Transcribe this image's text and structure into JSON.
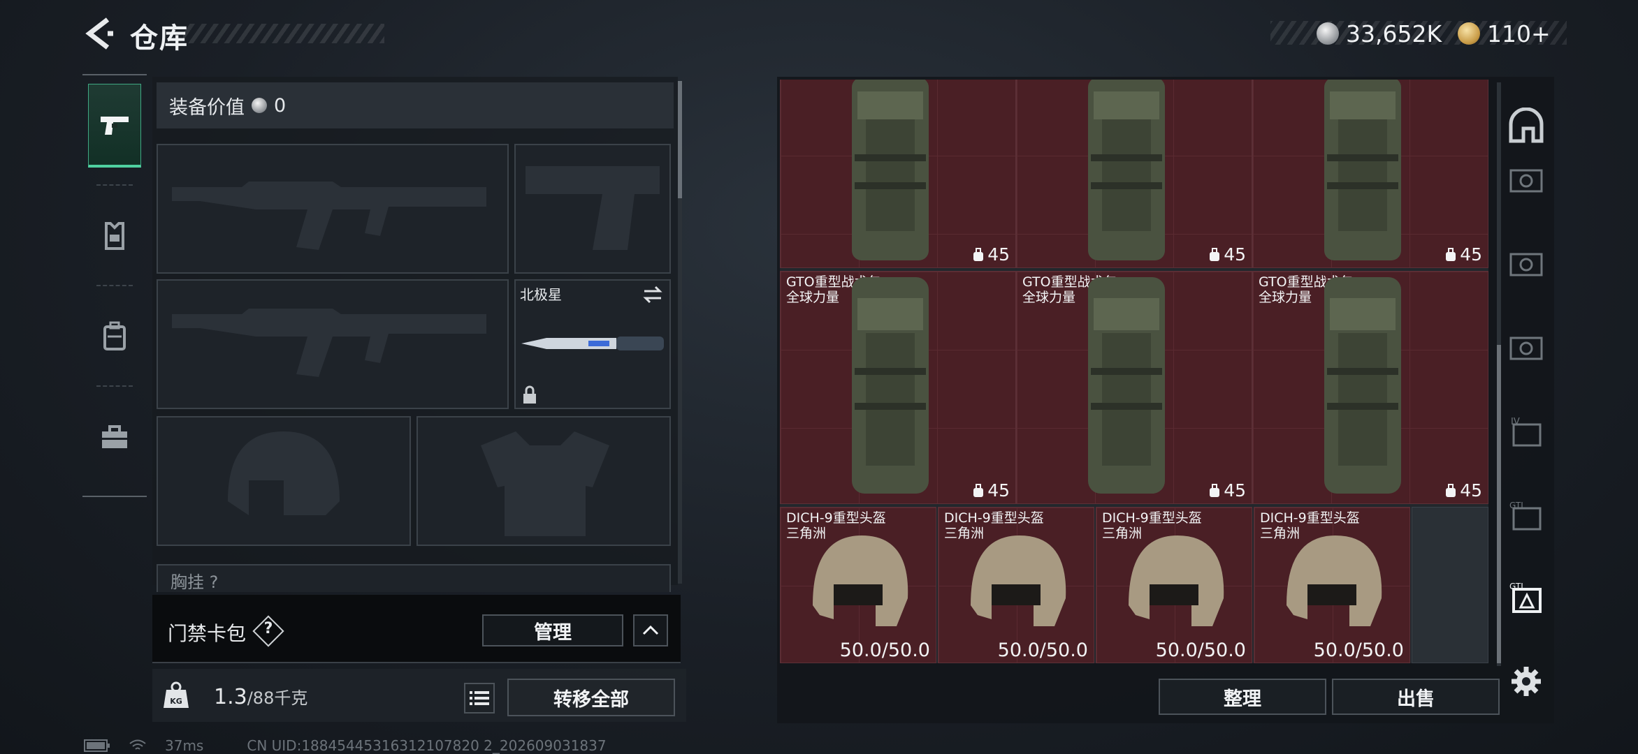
{
  "header": {
    "title": "仓库",
    "currencies": [
      {
        "icon": "silver-coin-icon",
        "value": "33,652K"
      },
      {
        "icon": "gold-coin-icon",
        "value": "110+"
      }
    ]
  },
  "tabs": [
    {
      "name": "pistol-icon",
      "active": true
    },
    {
      "name": "armor-rig-icon",
      "active": false
    },
    {
      "name": "backpack-icon",
      "active": false
    },
    {
      "name": "toolbox-icon",
      "active": false
    }
  ],
  "equipment": {
    "value_label": "装备价值",
    "value": "0",
    "melee_name": "北极星",
    "next_section": "胸挂 ?"
  },
  "keycard": {
    "label": "门禁卡包",
    "help": "?",
    "manage_label": "管理"
  },
  "weight": {
    "current": "1.3",
    "capacity": "/88千克"
  },
  "transfer_all_label": "转移全部",
  "storage": {
    "backpacks": [
      {
        "name": "",
        "count": "45"
      },
      {
        "name": "",
        "count": "45"
      },
      {
        "name": "",
        "count": "45"
      },
      {
        "name": "GTO重型战术包\n全球力量",
        "count": "45"
      },
      {
        "name": "GTO重型战术包\n全球力量",
        "count": "45"
      },
      {
        "name": "GTO重型战术包\n全球力量",
        "count": "45"
      }
    ],
    "helmets": [
      {
        "name": "DICH-9重型头盔\n三角洲",
        "durability": "50.0/50.0"
      },
      {
        "name": "DICH-9重型头盔\n三角洲",
        "durability": "50.0/50.0"
      },
      {
        "name": "DICH-9重型头盔\n三角洲",
        "durability": "50.0/50.0"
      },
      {
        "name": "DICH-9重型头盔\n三角洲",
        "durability": "50.0/50.0"
      }
    ],
    "sort_label": "整理",
    "sell_label": "出售"
  },
  "rail": [
    "home-bunker-icon",
    "safe-box-icon-1",
    "safe-box-icon-2",
    "safe-box-icon-3",
    "tier-iv-case-icon",
    "gti-case-icon-1",
    "gti-case-icon-2",
    "settings-gear-icon"
  ],
  "status": {
    "ping": "37ms",
    "uid": "CN UID:18845445316312107820 2_202609031837"
  },
  "colors": {
    "accent": "#4fd0a0",
    "item_bg": "#4a1f25"
  }
}
